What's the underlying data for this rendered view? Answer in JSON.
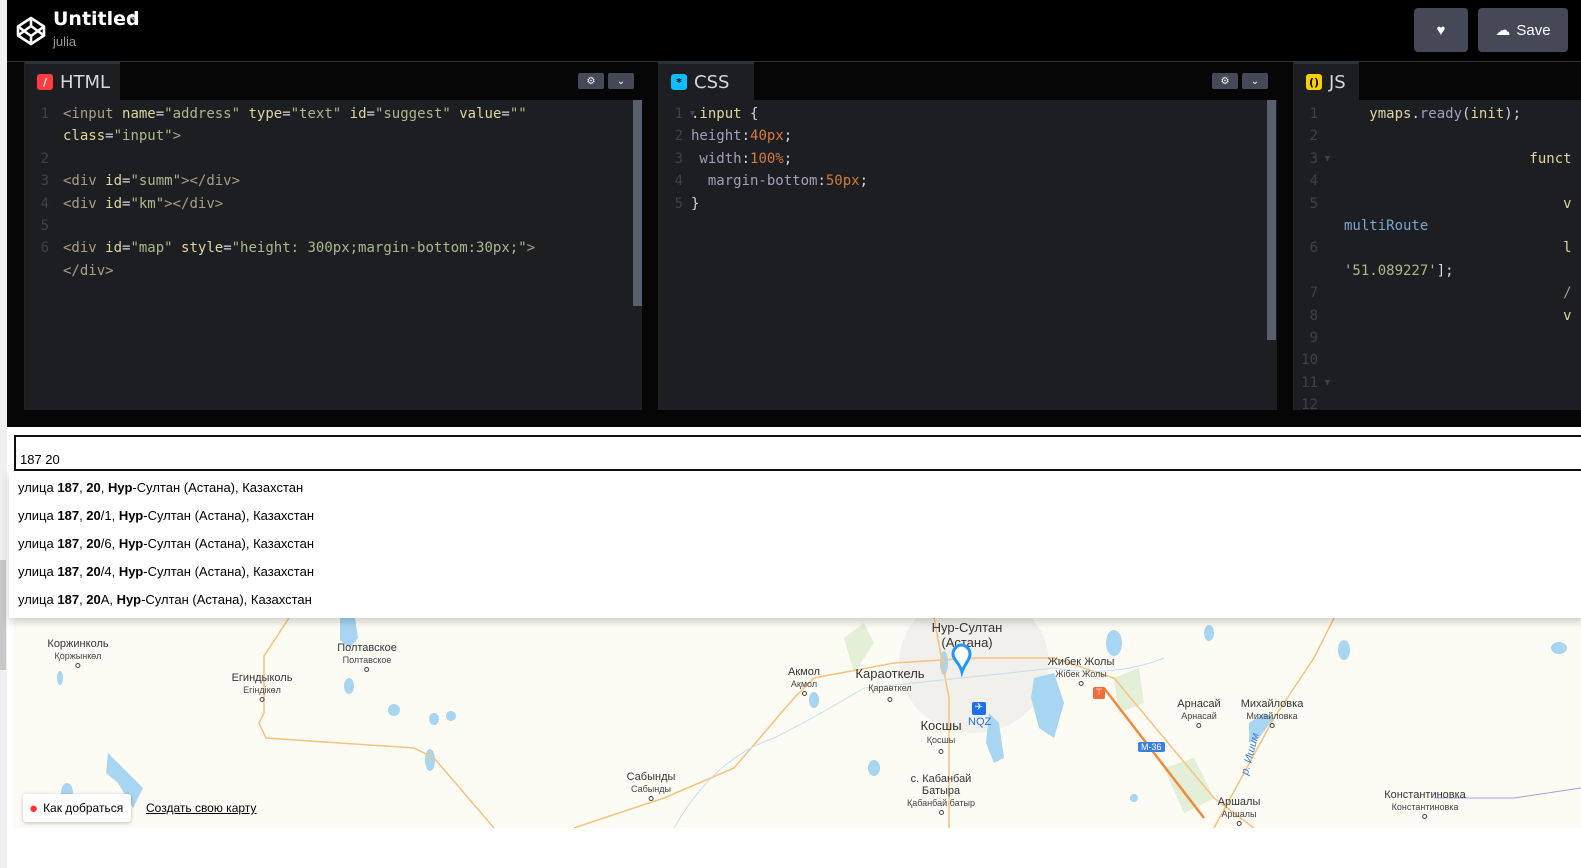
{
  "header": {
    "title": "Untitled",
    "author": "julia",
    "like_icon": "heart-icon",
    "save_label": "Save"
  },
  "editors": {
    "html": {
      "label": "HTML",
      "color": "#ff3c41",
      "lines": [
        {
          "n": "1",
          "parts": [
            [
              "t-tag",
              "<input "
            ],
            [
              "t-attr",
              "name"
            ],
            [
              "t-plain",
              "="
            ],
            [
              "t-str",
              "\"address\" "
            ],
            [
              "t-attr",
              "type"
            ],
            [
              "t-plain",
              "="
            ],
            [
              "t-str",
              "\"text\" "
            ],
            [
              "t-attr",
              "id"
            ],
            [
              "t-plain",
              "="
            ],
            [
              "t-str",
              "\"suggest\" "
            ],
            [
              "t-attr",
              "value"
            ],
            [
              "t-plain",
              "="
            ],
            [
              "t-str",
              "\"\""
            ]
          ]
        },
        {
          "n": "",
          "parts": [
            [
              "t-attr",
              "class"
            ],
            [
              "t-plain",
              "="
            ],
            [
              "t-str",
              "\"input\""
            ],
            [
              "t-tag",
              ">"
            ]
          ]
        },
        {
          "n": "2",
          "parts": []
        },
        {
          "n": "3",
          "parts": [
            [
              "t-tag",
              "<div "
            ],
            [
              "t-attr",
              "id"
            ],
            [
              "t-plain",
              "="
            ],
            [
              "t-str",
              "\"summ\""
            ],
            [
              "t-tag",
              "></div>"
            ]
          ]
        },
        {
          "n": "4",
          "parts": [
            [
              "t-tag",
              "<div "
            ],
            [
              "t-attr",
              "id"
            ],
            [
              "t-plain",
              "="
            ],
            [
              "t-str",
              "\"km\""
            ],
            [
              "t-tag",
              "></div>"
            ]
          ]
        },
        {
          "n": "5",
          "parts": []
        },
        {
          "n": "6",
          "parts": [
            [
              "t-tag",
              "<div "
            ],
            [
              "t-attr",
              "id"
            ],
            [
              "t-plain",
              "="
            ],
            [
              "t-str",
              "\"map\" "
            ],
            [
              "t-attr",
              "style"
            ],
            [
              "t-plain",
              "="
            ],
            [
              "t-str",
              "\"height: 300px;margin-bottom:30px;\""
            ],
            [
              "t-tag",
              ">"
            ]
          ]
        },
        {
          "n": "",
          "parts": [
            [
              "t-tag",
              "</div>"
            ]
          ]
        }
      ]
    },
    "css": {
      "label": "CSS",
      "color": "#0ebeff",
      "lines": [
        {
          "n": "1",
          "fold": true,
          "parts": [
            [
              "t-sel",
              ".input "
            ],
            [
              "t-plain",
              "{"
            ]
          ]
        },
        {
          "n": "2",
          "parts": [
            [
              "t-prop",
              "height"
            ],
            [
              "t-plain",
              ":"
            ],
            [
              "t-num",
              "40px"
            ],
            [
              "t-plain",
              ";"
            ]
          ]
        },
        {
          "n": "3",
          "parts": [
            [
              "t-prop",
              " width"
            ],
            [
              "t-plain",
              ":"
            ],
            [
              "t-num",
              "100%"
            ],
            [
              "t-plain",
              ";"
            ]
          ]
        },
        {
          "n": "4",
          "parts": [
            [
              "t-prop",
              "  margin-bottom"
            ],
            [
              "t-plain",
              ":"
            ],
            [
              "t-num",
              "50px"
            ],
            [
              "t-plain",
              ";"
            ]
          ]
        },
        {
          "n": "5",
          "parts": [
            [
              "t-plain",
              "}"
            ]
          ]
        }
      ]
    },
    "js": {
      "label": "JS",
      "color": "#fcd000",
      "lines": [
        {
          "n": "1",
          "parts": [
            [
              "t-attr",
              "   ymaps"
            ],
            [
              "t-plain",
              "."
            ],
            [
              "t-prop",
              "ready"
            ],
            [
              "t-plain",
              "("
            ],
            [
              "t-attr",
              "init"
            ],
            [
              "t-plain",
              ");"
            ]
          ]
        },
        {
          "n": "2",
          "parts": []
        },
        {
          "n": "3",
          "fold": true,
          "parts": [
            [
              "t-attr",
              "                      funct"
            ]
          ]
        },
        {
          "n": "4",
          "parts": []
        },
        {
          "n": "5",
          "parts": [
            [
              "t-attr",
              "                          v"
            ]
          ]
        },
        {
          "n": "",
          "parts": [
            [
              "t-var",
              "multiRoute"
            ]
          ]
        },
        {
          "n": "6",
          "parts": [
            [
              "t-attr",
              "                          l"
            ]
          ]
        },
        {
          "n": "",
          "parts": [
            [
              "t-str",
              "'51.089227'"
            ],
            [
              "t-plain",
              "];"
            ]
          ]
        },
        {
          "n": "7",
          "parts": [
            [
              "t-tag",
              "                          /"
            ]
          ]
        },
        {
          "n": "8",
          "parts": [
            [
              "t-attr",
              "                          v"
            ]
          ]
        },
        {
          "n": "9",
          "parts": []
        },
        {
          "n": "10",
          "parts": []
        },
        {
          "n": "11",
          "fold": true,
          "parts": []
        },
        {
          "n": "12",
          "parts": []
        }
      ]
    }
  },
  "search": {
    "value": "187 20"
  },
  "suggestions": [
    [
      [
        "",
        "улица "
      ],
      [
        "b",
        "187"
      ],
      [
        "",
        ", "
      ],
      [
        "b",
        "20"
      ],
      [
        "",
        ", "
      ],
      [
        "b",
        "Нур"
      ],
      [
        "",
        "-Султан (Астана), Казахстан"
      ]
    ],
    [
      [
        "",
        "улица "
      ],
      [
        "b",
        "187"
      ],
      [
        "",
        ", "
      ],
      [
        "b",
        "20"
      ],
      [
        "",
        "/1, "
      ],
      [
        "b",
        "Нур"
      ],
      [
        "",
        "-Султан (Астана), Казахстан"
      ]
    ],
    [
      [
        "",
        "улица "
      ],
      [
        "b",
        "187"
      ],
      [
        "",
        ", "
      ],
      [
        "b",
        "20"
      ],
      [
        "",
        "/6, "
      ],
      [
        "b",
        "Нур"
      ],
      [
        "",
        "-Султан (Астана), Казахстан"
      ]
    ],
    [
      [
        "",
        "улица "
      ],
      [
        "b",
        "187"
      ],
      [
        "",
        ", "
      ],
      [
        "b",
        "20"
      ],
      [
        "",
        "/4, "
      ],
      [
        "b",
        "Нур"
      ],
      [
        "",
        "-Султан (Астана), Казахстан"
      ]
    ],
    [
      [
        "",
        "улица "
      ],
      [
        "b",
        "187"
      ],
      [
        "",
        ", "
      ],
      [
        "b",
        "20"
      ],
      [
        "",
        "А, "
      ],
      [
        "b",
        "Нур"
      ],
      [
        "",
        "-Султан (Астана), Казахстан"
      ]
    ]
  ],
  "map": {
    "route_button": "Как добраться",
    "create_map_link": "Создать свою карту",
    "airport_code": "NQZ",
    "road_label": "М-36",
    "river_label": "р. Ишим",
    "places": [
      {
        "name": "Коржинколь",
        "sub": "Қоржынкөл"
      },
      {
        "name": "Полтавское",
        "sub": "Полтавское"
      },
      {
        "name": "Егиндыколь",
        "sub": "Егіндікөл"
      },
      {
        "name": "Акмол",
        "sub": "Ақмол"
      },
      {
        "name": "Караоткель",
        "sub": "Қараөткел"
      },
      {
        "name": "Нур-Султан (Астана)",
        "sub": ""
      },
      {
        "name": "Жибек Жолы",
        "sub": "Жібек Жолы"
      },
      {
        "name": "Косшы",
        "sub": "Қосшы"
      },
      {
        "name": "Арнасай",
        "sub": "Арнасай"
      },
      {
        "name": "Михайловка",
        "sub": "Михайловка"
      },
      {
        "name": "Сабынды",
        "sub": "Сабынды"
      },
      {
        "name": "с. Кабанбай Батыра",
        "sub": "Қабанбай батыр"
      },
      {
        "name": "Аршалы",
        "sub": "Аршалы"
      },
      {
        "name": "Константиновка",
        "sub": "Константиновка"
      }
    ]
  }
}
